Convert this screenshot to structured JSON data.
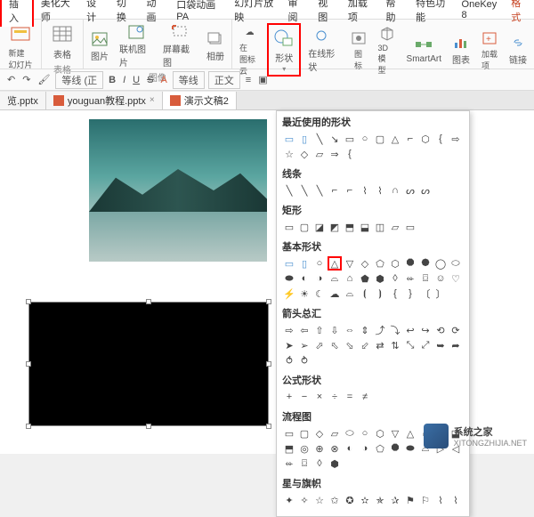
{
  "tabs": {
    "insert": "插入",
    "beautify": "美化大师",
    "design": "设计",
    "transition": "切换",
    "animation": "动画",
    "pocket_anim": "口袋动画 PA",
    "slideshow": "幻灯片放映",
    "review": "审阅",
    "view": "视图",
    "addon": "加载项",
    "help": "帮助",
    "special": "特色功能",
    "onekey": "OneKey 8",
    "format": "格式"
  },
  "ribbon": {
    "new_slide": "新建幻灯片",
    "table": "表格",
    "pictures": "图片",
    "online_pic": "联机图片",
    "screenshot": "屏幕截图",
    "album": "相册",
    "icon_lib": "在图标云",
    "shapes": "形状",
    "online_shapes": "在线形状",
    "icons": "图标",
    "model3d": "3D 模型",
    "smartart": "SmartArt",
    "chart": "图表",
    "addin": "加载项",
    "link": "链接",
    "group_tables": "表格",
    "group_images": "图像"
  },
  "format_bar": {
    "font": "等线 (正",
    "bold": "B",
    "italic": "I",
    "underline": "U",
    "strike": "S",
    "super": "A",
    "line": "等线",
    "style": "正文"
  },
  "files": {
    "f1": "览.pptx",
    "f2": "youguan教程.pptx",
    "f3": "演示文稿2"
  },
  "dropdown": {
    "recent": "最近使用的形状",
    "lines": "线条",
    "rect": "矩形",
    "basic": "基本形状",
    "arrows": "箭头总汇",
    "formula": "公式形状",
    "flowchart": "流程图",
    "stars": "星与旗帜"
  },
  "watermark": {
    "name": "系统之家",
    "url": "XITONGZHIJIA.NET"
  }
}
